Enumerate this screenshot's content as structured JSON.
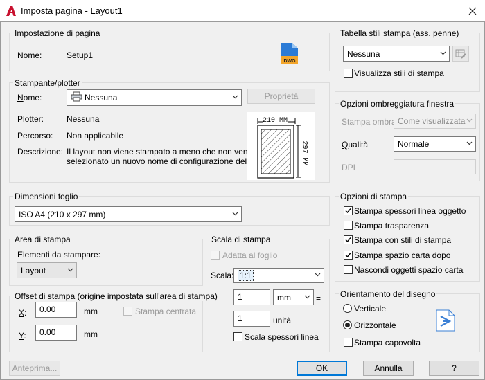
{
  "window": {
    "title": "Imposta pagina - Layout1"
  },
  "page_setup": {
    "group_title": "Impostazione di pagina",
    "name_label": "Nome:",
    "name_value": "Setup1",
    "dwg_icon_text": "DWG"
  },
  "printer": {
    "group_title": "Stampante/plotter",
    "name_label": "Nome:",
    "name_value": "Nessuna",
    "properties_button": "Proprietà",
    "plotter_label": "Plotter:",
    "plotter_value": "Nessuna",
    "path_label": "Percorso:",
    "path_value": "Non applicabile",
    "description_label": "Descrizione:",
    "description_line1": "Il layout non viene stampato a meno che non venga",
    "description_line2": "selezionato un nuovo nome di configurazione della",
    "paper_width_label": "210 MM",
    "paper_height_label": "297 MM"
  },
  "paper_size": {
    "group_title": "Dimensioni foglio",
    "value": "ISO A4 (210 x 297 mm)"
  },
  "plot_area": {
    "group_title": "Area di stampa",
    "what_label": "Elementi da stampare:",
    "what_value": "Layout"
  },
  "plot_offset": {
    "group_title": "Offset di stampa (origine impostata sull'area di stampa)",
    "x_label": "X:",
    "x_value": "0.00",
    "x_unit": "mm",
    "y_label": "Y:",
    "y_value": "0.00",
    "y_unit": "mm",
    "center_label": "Stampa centrata"
  },
  "plot_scale": {
    "group_title": "Scala di stampa",
    "fit_label": "Adatta al foglio",
    "scale_label": "Scala:",
    "scale_value": "1:1",
    "value1": "1",
    "unit_value": "mm",
    "equals": "=",
    "value2": "1",
    "unit2_label": "unità",
    "lineweights_label": "Scala spessori linea"
  },
  "style_table": {
    "group_title": "Tabella stili stampa (ass. penne)",
    "value": "Nessuna",
    "display_label": "Visualizza stili di stampa"
  },
  "shaded_viewport": {
    "group_title": "Opzioni ombreggiatura finestra",
    "shade_label": "Stampa ombra",
    "shade_value": "Come visualizzata",
    "quality_label": "Qualità",
    "quality_value": "Normale",
    "dpi_label": "DPI"
  },
  "plot_options": {
    "group_title": "Opzioni di stampa",
    "items": [
      {
        "label": "Stampa spessori linea oggetto",
        "checked": true
      },
      {
        "label": "Stampa trasparenza",
        "checked": false
      },
      {
        "label": "Stampa con stili di stampa",
        "checked": true
      },
      {
        "label": "Stampa spazio carta dopo",
        "checked": true
      },
      {
        "label": "Nascondi oggetti spazio carta",
        "checked": false
      }
    ]
  },
  "orientation": {
    "group_title": "Orientamento del disegno",
    "portrait_label": "Verticale",
    "landscape_label": "Orizzontale",
    "upside_down_label": "Stampa capovolta",
    "selected": "Orizzontale"
  },
  "buttons": {
    "preview": "Anteprima...",
    "ok": "OK",
    "cancel": "Annulla",
    "help": "?"
  },
  "colors": {
    "accent": "#0078d7",
    "autocad_red": "#c8102e"
  }
}
